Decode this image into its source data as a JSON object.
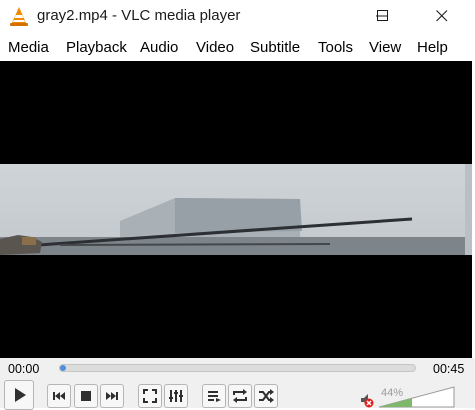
{
  "window": {
    "title": "gray2.mp4 - VLC media player"
  },
  "menu": {
    "items": [
      "Media",
      "Playback",
      "Audio",
      "Video",
      "Subtitle",
      "Tools",
      "View",
      "Help"
    ]
  },
  "playback": {
    "elapsed": "00:00",
    "total": "00:45",
    "progress_fraction": 0.005
  },
  "volume": {
    "label": "44%",
    "level_fraction": 0.44,
    "muted": true
  },
  "icons": {
    "logo": "vlc-cone-icon",
    "minimize": "minimize-icon",
    "maximize": "maximize-icon",
    "close": "close-icon",
    "play": "play-icon",
    "previous": "previous-icon",
    "stop": "stop-icon",
    "next": "next-icon",
    "fullscreen": "fullscreen-icon",
    "extended": "equalizer-icon",
    "playlist": "playlist-icon",
    "loop": "loop-icon",
    "shuffle": "shuffle-icon",
    "mute": "mute-icon"
  },
  "colors": {
    "accent": "#4f8fdc",
    "vlc_orange": "#f28a00",
    "mute_red": "#e0201c"
  }
}
